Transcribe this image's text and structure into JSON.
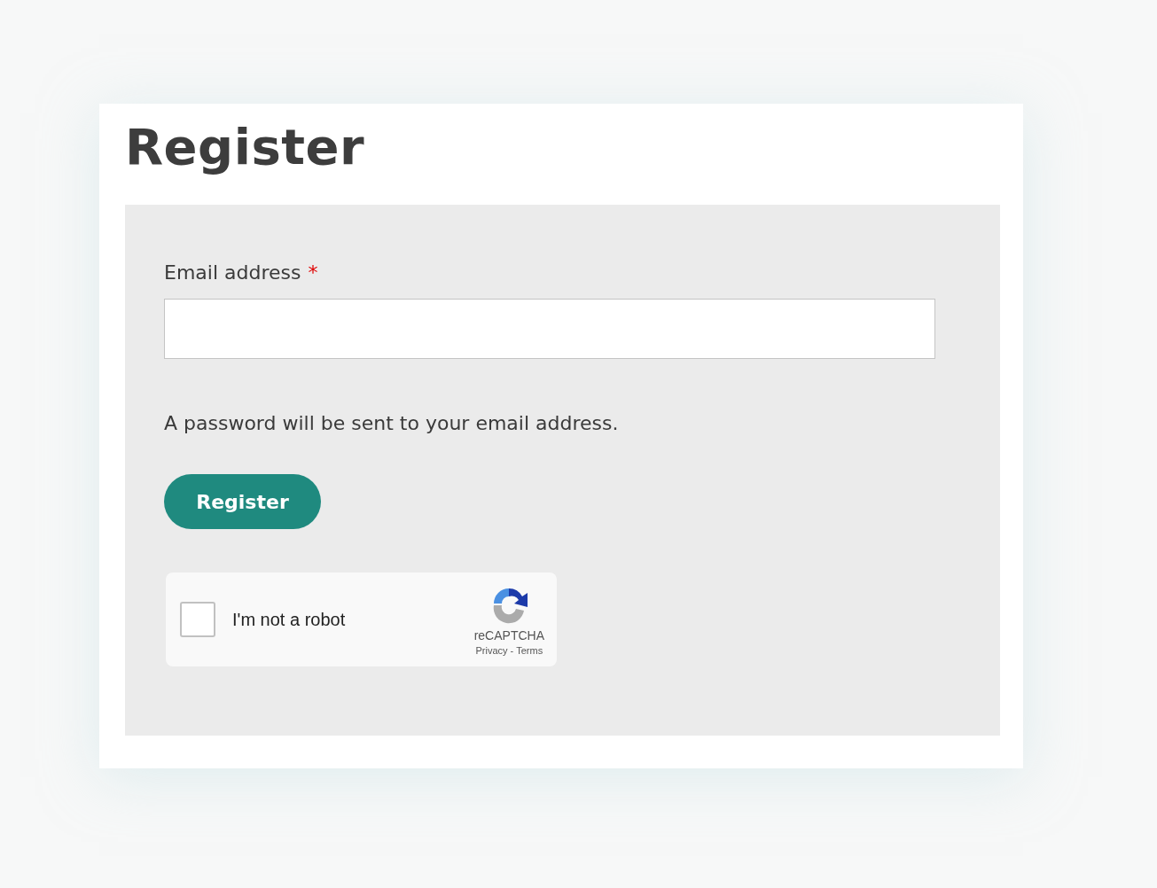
{
  "title": "Register",
  "email_field": {
    "label": "Email address",
    "required": true,
    "required_mark": "*"
  },
  "hint": "A password will be sent to your email address.",
  "submit_button": "Register",
  "captcha": {
    "checked": false,
    "label": "I'm not a robot",
    "brand": "reCAPTCHA",
    "links": [
      "Privacy",
      "Terms"
    ],
    "separator": "-"
  }
}
